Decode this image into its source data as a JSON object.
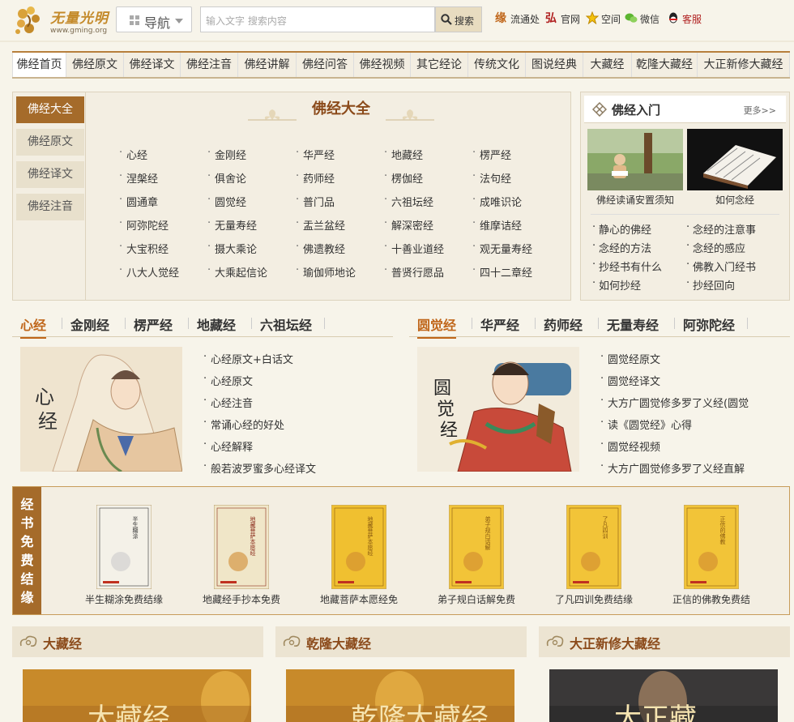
{
  "header": {
    "logo_name": "无量光明",
    "logo_url": "www.gming.org",
    "nav_label": "导航",
    "search_placeholder": "输入文字  搜索内容",
    "search_button": "搜索",
    "links": [
      {
        "label": "流通处",
        "icon": "yuan-icon"
      },
      {
        "label": "官网",
        "icon": "hong-icon"
      },
      {
        "label": "空间",
        "icon": "star-icon"
      },
      {
        "label": "微信",
        "icon": "wechat-icon"
      },
      {
        "label": "客服",
        "icon": "qq-icon"
      }
    ]
  },
  "mainnav": [
    "佛经首页",
    "佛经原文",
    "佛经译文",
    "佛经注音",
    "佛经讲解",
    "佛经问答",
    "佛经视频",
    "其它经论",
    "传统文化",
    "图说经典",
    "大藏经",
    "乾隆大藏经",
    "大正新修大藏经"
  ],
  "panel1": {
    "tabs": [
      "佛经大全",
      "佛经原文",
      "佛经译文",
      "佛经注音"
    ],
    "title": "佛经大全",
    "sutras": [
      [
        "心经",
        "金刚经",
        "华严经",
        "地藏经",
        "楞严经"
      ],
      [
        "涅槃经",
        "俱舍论",
        "药师经",
        "楞伽经",
        "法句经"
      ],
      [
        "圆通章",
        "圆觉经",
        "普门品",
        "六祖坛经",
        "成唯识论"
      ],
      [
        "阿弥陀经",
        "无量寿经",
        "盂兰盆经",
        "解深密经",
        "维摩诘经"
      ],
      [
        "大宝积经",
        "摄大乘论",
        "佛遗教经",
        "十善业道经",
        "观无量寿经"
      ],
      [
        "八大人觉经",
        "大乘起信论",
        "瑜伽师地论",
        "普贤行愿品",
        "四十二章经"
      ]
    ]
  },
  "intro": {
    "title": "佛经入门",
    "more": "更多>>",
    "thumbs": [
      "佛经读诵安置须知",
      "如何念经"
    ],
    "links": [
      [
        "静心的佛经",
        "念经的注意事"
      ],
      [
        "念经的方法",
        "念经的感应"
      ],
      [
        "抄经书有什么",
        "佛教入门经书"
      ],
      [
        "如何抄经",
        "抄经回向"
      ]
    ]
  },
  "sec1": {
    "tabs": [
      "心经",
      "金刚经",
      "楞严经",
      "地藏经",
      "六祖坛经"
    ],
    "pic_text": "心经",
    "items": [
      "心经原文+白话文",
      "心经原文",
      "心经注音",
      "常诵心经的好处",
      "心经解释",
      "般若波罗蜜多心经译文"
    ]
  },
  "sec2": {
    "tabs": [
      "圆觉经",
      "华严经",
      "药师经",
      "无量寿经",
      "阿弥陀经"
    ],
    "pic_text": "圆觉经",
    "items": [
      "圆觉经原文",
      "圆觉经译文",
      "大方广圆觉修多罗了义经(圆觉",
      "读《圆觉经》心得",
      "圆觉经视频",
      "大方广圆觉修多罗了义经直解"
    ]
  },
  "books": {
    "side_label": "经书免费结缘",
    "items": [
      {
        "caption": "半生糊涂免费结缘",
        "cover": "半生糊涂"
      },
      {
        "caption": "地藏经手抄本免费",
        "cover": "地藏菩萨本愿经"
      },
      {
        "caption": "地藏菩萨本愿经免",
        "cover": "地藏菩萨本愿经"
      },
      {
        "caption": "弟子规白话解免费",
        "cover": "弟子规白话解"
      },
      {
        "caption": "了凡四训免费结缘",
        "cover": "了凡四训"
      },
      {
        "caption": "正信的佛教免费结",
        "cover": "正信的佛教"
      }
    ]
  },
  "bottom": [
    {
      "title": "大藏经",
      "pic": "大藏经"
    },
    {
      "title": "乾隆大藏经",
      "pic": "乾隆大藏经"
    },
    {
      "title": "大正新修大藏经",
      "pic": "大正藏"
    }
  ],
  "colors": {
    "brown": "#a56b2a",
    "accent": "#c0661a",
    "bg": "#f7f4ea"
  }
}
